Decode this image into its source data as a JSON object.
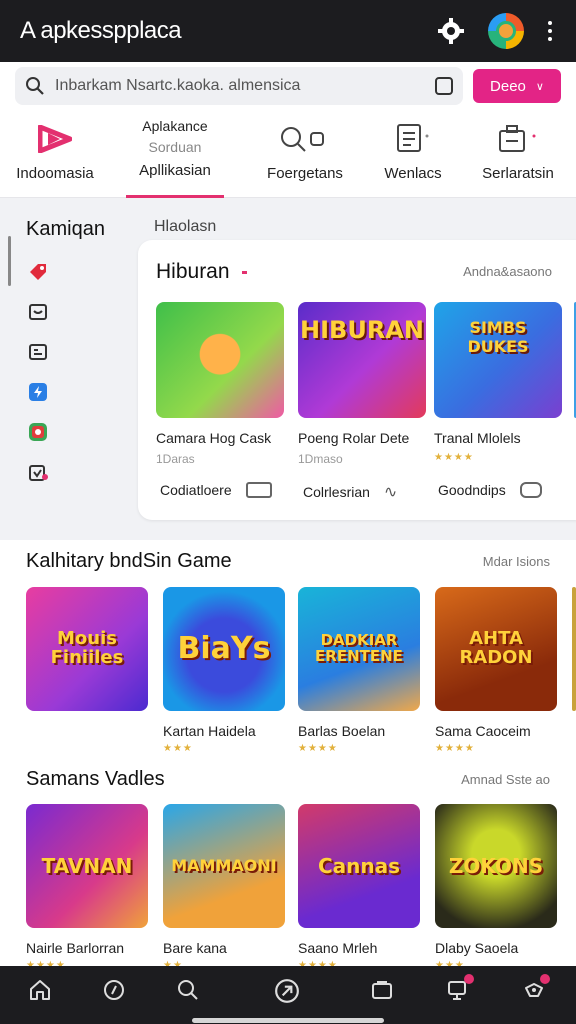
{
  "app": {
    "title": "A apkesspplaca"
  },
  "search": {
    "value": "Inbarkam Nsartc.kaoka. almensica",
    "deal_label": "Deeo"
  },
  "tabs": [
    {
      "label": "Indoomasia",
      "icon": "play-logo-icon"
    },
    {
      "top": "Aplakance",
      "sub": "Sorduan",
      "label": "Apllikasian",
      "active": true
    },
    {
      "label": "Foergetans",
      "icon": "search-person-icon"
    },
    {
      "label": "Wenlacs",
      "icon": "document-icon"
    },
    {
      "label": "Serlaratsin",
      "icon": "briefcase-icon"
    }
  ],
  "rail": {
    "heading": "Kamiqan",
    "subheading": "Hlaolasn"
  },
  "hiburan": {
    "title": "Hiburan",
    "link": "Andna&asaono",
    "apps": [
      {
        "name": "Camara Hog Cask",
        "meta": "1Daras",
        "art": ""
      },
      {
        "name": "Poeng Rolar Dete",
        "meta": "1Dmaso",
        "art": "HIBURAN"
      },
      {
        "name": "Tranal Mlolels",
        "stars": "★★★★",
        "art": "SIMBS DUKES"
      }
    ],
    "actions": [
      "Codiatloere",
      "Colrlesrian",
      "Goodndips"
    ]
  },
  "section1": {
    "title": "Kalhitary bndSin Game",
    "link": "Mdar Isions",
    "items": [
      {
        "name": "",
        "art": "Mouis Finiiles"
      },
      {
        "name": "Kartan Haidela",
        "stars": "★★★",
        "art": "BiaYs"
      },
      {
        "name": "Barlas Boelan",
        "stars": "★★★★",
        "art": "DADKIAR ERENTENE"
      },
      {
        "name": "Sama Caoceim",
        "stars": "★★★★",
        "art": "AHTA RADON"
      }
    ]
  },
  "section2": {
    "title": "Samans Vadles",
    "link": "Amnad Sste ao",
    "items": [
      {
        "name": "Nairle Barlorran",
        "stars": "★★★★",
        "art": "TAVNAN"
      },
      {
        "name": "Bare kana",
        "stars": "★★",
        "art": "MAMMAONI"
      },
      {
        "name": "Saano Mrleh",
        "stars": "★★★★",
        "art": "Cannas"
      },
      {
        "name": "Dlaby Saoela",
        "stars": "★★★",
        "art": "ZOKONS"
      }
    ]
  },
  "colors": {
    "accent": "#e32486",
    "dark": "#1c1c1f"
  }
}
